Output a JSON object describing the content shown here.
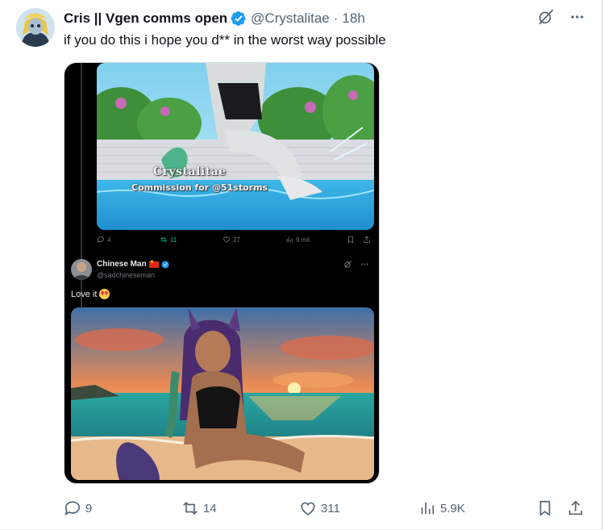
{
  "tweet": {
    "display_name": "Cris || Vgen comms open",
    "handle": "@Crystalitae",
    "separator": "·",
    "time": "18h",
    "text": "if you do this i hope you d** in the worst way possible"
  },
  "media": {
    "embedded_post": {
      "watermark_name": "Crystalitae",
      "watermark_credit": "Commission for @51storms",
      "stats": {
        "replies": "4",
        "reposts": "11",
        "likes": "27",
        "views": "9 mil"
      }
    },
    "reply": {
      "name": "Chinese Man",
      "handle": "@sadchineseman",
      "text": "Love it"
    }
  },
  "actions": {
    "replies": "9",
    "reposts": "14",
    "likes": "311",
    "views": "5.9K"
  },
  "icons": {
    "verified": "verified-badge-icon",
    "grok": "grok-icon",
    "more": "more-icon",
    "reply": "reply-icon",
    "repost": "repost-icon",
    "like": "heart-icon",
    "views": "views-icon",
    "bookmark": "bookmark-icon",
    "share": "share-icon"
  },
  "colors": {
    "text": "#0f1419",
    "secondary": "#536471",
    "verified": "#1d9bf0",
    "repost_green": "#00ba7c",
    "media_bg": "#000000"
  }
}
